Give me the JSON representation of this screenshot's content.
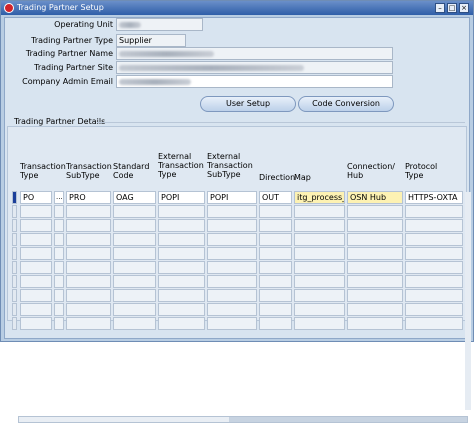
{
  "window": {
    "title": "Trading Partner Setup",
    "controls": [
      "–",
      "□",
      "×"
    ]
  },
  "form": {
    "operating_unit_label": "Operating Unit",
    "trading_partner_type_label": "Trading Partner Type",
    "trading_partner_type_value": "Supplier",
    "trading_partner_name_label": "Trading Partner Name",
    "trading_partner_site_label": "Trading Partner Site",
    "company_admin_email_label": "Company Admin Email"
  },
  "buttons": {
    "user_setup": "User Setup",
    "code_conversion": "Code Conversion"
  },
  "details": {
    "section_title": "Trading Partner Details",
    "columns": [
      {
        "name": "Transaction Type",
        "lines": [
          "Transaction",
          "Type"
        ]
      },
      {
        "name": "Transaction SubType",
        "lines": [
          "Transaction",
          "SubType"
        ]
      },
      {
        "name": "Standard Code",
        "lines": [
          "Standard",
          "Code"
        ]
      },
      {
        "name": "External Transaction Type",
        "lines": [
          "External",
          "Transaction",
          "Type"
        ]
      },
      {
        "name": "External Transaction SubType",
        "lines": [
          "External",
          "Transaction",
          "SubType"
        ]
      },
      {
        "name": "Direction",
        "lines": [
          "Direction"
        ]
      },
      {
        "name": "Map",
        "lines": [
          "Map"
        ]
      },
      {
        "name": "Connection/ Hub",
        "lines": [
          "Connection/",
          "Hub"
        ]
      },
      {
        "name": "Protocol Type",
        "lines": [
          "Protocol",
          "Type"
        ]
      }
    ],
    "rows": [
      {
        "transaction_type": "PO",
        "transaction_subtype": "PRO",
        "standard_code": "OAG",
        "external_transaction_type": "POPI",
        "external_transaction_subtype": "POPI",
        "direction": "OUT",
        "map": "itg_process_p",
        "connection_hub": "OSN Hub",
        "protocol_type": "HTTPS-OXTA"
      }
    ],
    "lov_button": "..."
  }
}
